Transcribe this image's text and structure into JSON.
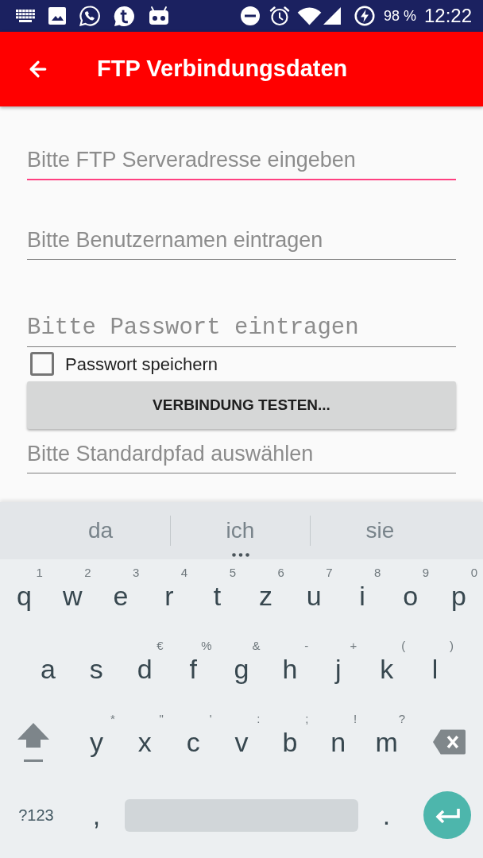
{
  "status_bar": {
    "battery": "98 %",
    "time": "12:22"
  },
  "app_bar": {
    "title": "FTP Verbindungsdaten"
  },
  "form": {
    "items": [
      {
        "kind": "text_field",
        "placeholder": "Bitte FTP Serveradresse eingeben",
        "focused": true
      },
      {
        "kind": "text_field",
        "placeholder": "Bitte Benutzernamen eintragen",
        "focused": false
      },
      {
        "kind": "password_field",
        "placeholder": "Bitte Passwort eintragen",
        "focused": false
      },
      {
        "kind": "checkbox",
        "label": "Passwort speichern",
        "checked": false
      },
      {
        "kind": "button",
        "label": "VERBINDUNG TESTEN..."
      },
      {
        "kind": "text_field",
        "placeholder": "Bitte Standardpfad auswählen",
        "focused": false
      }
    ]
  },
  "keyboard": {
    "suggestions": [
      {
        "text": "da",
        "more": false
      },
      {
        "text": "ich",
        "more": true
      },
      {
        "text": "sie",
        "more": false
      }
    ],
    "rows": [
      {
        "keys": [
          {
            "kind": "letter",
            "label": "q",
            "hint": "1"
          },
          {
            "kind": "letter",
            "label": "w",
            "hint": "2"
          },
          {
            "kind": "letter",
            "label": "e",
            "hint": "3"
          },
          {
            "kind": "letter",
            "label": "r",
            "hint": "4"
          },
          {
            "kind": "letter",
            "label": "t",
            "hint": "5"
          },
          {
            "kind": "letter",
            "label": "z",
            "hint": "6"
          },
          {
            "kind": "letter",
            "label": "u",
            "hint": "7"
          },
          {
            "kind": "letter",
            "label": "i",
            "hint": "8"
          },
          {
            "kind": "letter",
            "label": "o",
            "hint": "9"
          },
          {
            "kind": "letter",
            "label": "p",
            "hint": "0"
          }
        ]
      },
      {
        "keys": [
          {
            "kind": "letter",
            "label": "a"
          },
          {
            "kind": "letter",
            "label": "s"
          },
          {
            "kind": "letter",
            "label": "d",
            "hint": "€"
          },
          {
            "kind": "letter",
            "label": "f",
            "hint": "%"
          },
          {
            "kind": "letter",
            "label": "g",
            "hint": "&"
          },
          {
            "kind": "letter",
            "label": "h",
            "hint": "-"
          },
          {
            "kind": "letter",
            "label": "j",
            "hint": "+"
          },
          {
            "kind": "letter",
            "label": "k",
            "hint": "("
          },
          {
            "kind": "letter",
            "label": "l",
            "hint": ")"
          }
        ]
      },
      {
        "keys": [
          {
            "kind": "shift"
          },
          {
            "kind": "letter",
            "label": "y",
            "hint": "*"
          },
          {
            "kind": "letter",
            "label": "x",
            "hint": "\""
          },
          {
            "kind": "letter",
            "label": "c",
            "hint": "'"
          },
          {
            "kind": "letter",
            "label": "v",
            "hint": ":"
          },
          {
            "kind": "letter",
            "label": "b",
            "hint": ";"
          },
          {
            "kind": "letter",
            "label": "n",
            "hint": "!"
          },
          {
            "kind": "letter",
            "label": "m",
            "hint": "?"
          },
          {
            "kind": "backspace"
          }
        ]
      },
      {
        "keys": [
          {
            "kind": "mode",
            "label": "?123"
          },
          {
            "kind": "punctuation",
            "label": ","
          },
          {
            "kind": "space"
          },
          {
            "kind": "punctuation",
            "label": "."
          },
          {
            "kind": "enter"
          }
        ]
      }
    ]
  }
}
